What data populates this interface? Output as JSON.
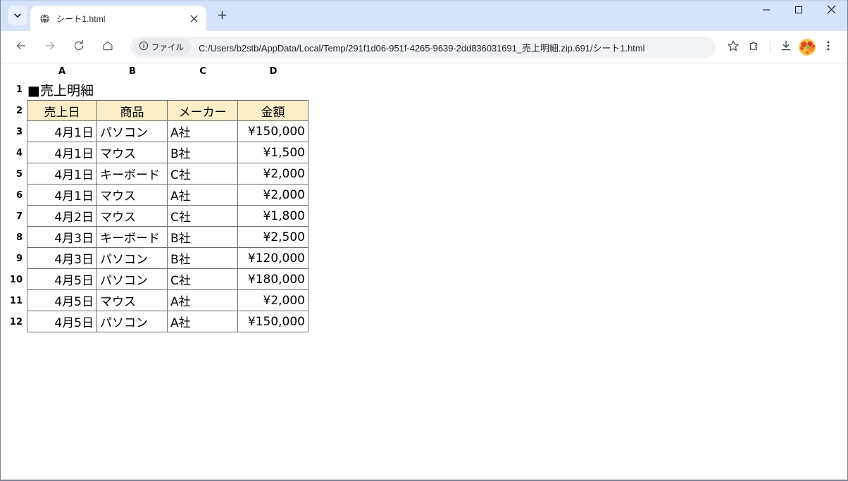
{
  "browser": {
    "tab_search_icon": "chevron-down-icon",
    "tab": {
      "favicon": "globe-icon",
      "title": "シート1.html",
      "close_icon": "close-icon"
    },
    "new_tab_icon": "plus-icon",
    "window_controls": {
      "minimize": "minimize-icon",
      "maximize": "maximize-icon",
      "close": "close-icon"
    },
    "toolbar": {
      "back_icon": "back-arrow-icon",
      "forward_icon": "forward-arrow-icon",
      "reload_icon": "reload-icon",
      "home_icon": "home-icon",
      "file_badge_icon": "info-circle-icon",
      "file_badge_label": "ファイル",
      "url": "C:/Users/b2stb/AppData/Local/Temp/291f1d06-951f-4265-9639-2dd836031691_売上明細.zip.691/シート1.html",
      "bookmark_icon": "star-icon",
      "extensions_icon": "puzzle-icon",
      "downloads_icon": "download-icon",
      "avatar_icon": "profile-avatar",
      "menu_icon": "three-dot-menu-icon"
    }
  },
  "sheet": {
    "column_letters": [
      "A",
      "B",
      "C",
      "D"
    ],
    "row_numbers": [
      "1",
      "2",
      "3",
      "4",
      "5",
      "6",
      "7",
      "8",
      "9",
      "10",
      "11",
      "12"
    ],
    "title": "■売上明細",
    "headers": [
      "売上日",
      "商品",
      "メーカー",
      "金額"
    ],
    "rows": [
      {
        "date": "4月1日",
        "product": "パソコン",
        "maker": "A社",
        "amount": "¥150,000"
      },
      {
        "date": "4月1日",
        "product": "マウス",
        "maker": "B社",
        "amount": "¥1,500"
      },
      {
        "date": "4月1日",
        "product": "キーボード",
        "maker": "C社",
        "amount": "¥2,000"
      },
      {
        "date": "4月1日",
        "product": "マウス",
        "maker": "A社",
        "amount": "¥2,000"
      },
      {
        "date": "4月2日",
        "product": "マウス",
        "maker": "C社",
        "amount": "¥1,800"
      },
      {
        "date": "4月3日",
        "product": "キーボード",
        "maker": "B社",
        "amount": "¥2,500"
      },
      {
        "date": "4月3日",
        "product": "パソコン",
        "maker": "B社",
        "amount": "¥120,000"
      },
      {
        "date": "4月5日",
        "product": "パソコン",
        "maker": "C社",
        "amount": "¥180,000"
      },
      {
        "date": "4月5日",
        "product": "マウス",
        "maker": "A社",
        "amount": "¥2,000"
      },
      {
        "date": "4月5日",
        "product": "パソコン",
        "maker": "A社",
        "amount": "¥150,000"
      }
    ]
  },
  "colors": {
    "tabstrip": "#d6e3fb",
    "header_fill": "#fceec9",
    "grid_line": "#6d6d6d",
    "omnibox": "#f1f3f4"
  }
}
